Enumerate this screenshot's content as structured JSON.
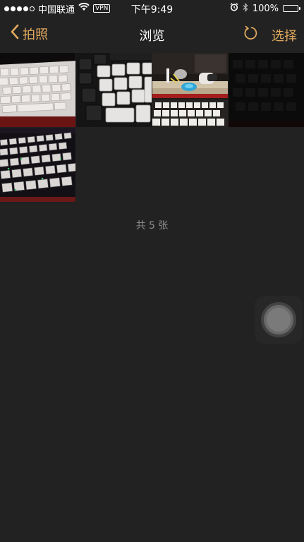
{
  "status_bar": {
    "carrier": "中国联通",
    "vpn": "VPN",
    "time": "下午9:49",
    "battery_percent": "100%",
    "signal_bars_filled": 4,
    "signal_bars_total": 5,
    "battery_level": 1.0,
    "icons": [
      "signal-icon",
      "wifi-icon",
      "alarm-icon",
      "bluetooth-icon",
      "battery-icon"
    ]
  },
  "nav": {
    "back_label": "拍照",
    "title": "浏览",
    "select_label": "选择",
    "refresh_icon": "refresh-icon",
    "back_icon": "chevron-left-icon"
  },
  "photos": [
    {
      "name": "photo-1",
      "subject": "white keyboard"
    },
    {
      "name": "photo-2",
      "subject": "keyboard keys closeup"
    },
    {
      "name": "photo-3",
      "subject": "desk with keyboard"
    },
    {
      "name": "photo-4",
      "subject": "dark keyboard"
    },
    {
      "name": "photo-5",
      "subject": "backlit keyboard"
    }
  ],
  "photo_count_label": "共 5 张",
  "colors": {
    "background": "#222222",
    "accent": "#e1a95f",
    "title": "#ffffff",
    "muted": "#8e8e8e"
  }
}
